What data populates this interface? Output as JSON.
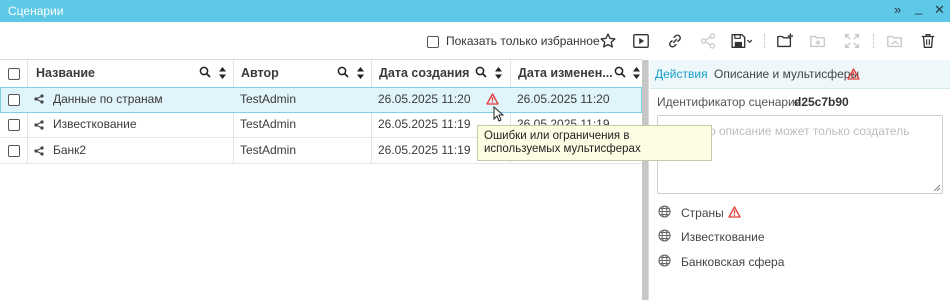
{
  "window": {
    "title": "Сценарии",
    "controls": [
      "»",
      "_",
      "✕"
    ]
  },
  "toolbar": {
    "favorites_label": "Показать только избранное",
    "icons": [
      "star-icon",
      "play-icon",
      "link-icon",
      "share-icon",
      "save-icon",
      "folder-add-icon",
      "folder-star-icon",
      "expand-icon",
      "folder-upload-icon",
      "trash-icon"
    ]
  },
  "grid": {
    "columns": [
      "Название",
      "Автор",
      "Дата создания",
      "Дата изменен..."
    ],
    "rows": [
      {
        "name": "Данные по странам",
        "author": "TestAdmin",
        "created": "26.05.2025 11:20",
        "modified": "26.05.2025 11:20",
        "warning": true,
        "selected": true
      },
      {
        "name": "Известкование",
        "author": "TestAdmin",
        "created": "26.05.2025 11:19",
        "modified": "26.05.2025 11:19"
      },
      {
        "name": "Банк2",
        "author": "TestAdmin",
        "created": "26.05.2025 11:19",
        "modified": ""
      }
    ]
  },
  "tooltip": {
    "text": "Ошибки или ограничения в используемых мультисферах"
  },
  "panel": {
    "tabs": [
      "Действия",
      "Описание и мультисферы"
    ],
    "id_label": "Идентификатор сценария:",
    "id_value": "d25c7b90",
    "description_placeholder": "о описание может только создатель",
    "multispheres": [
      {
        "name": "Страны",
        "warning": true
      },
      {
        "name": "Известкование"
      },
      {
        "name": "Банковская сфера"
      }
    ]
  },
  "colors": {
    "accent": "#5ec8e7",
    "tab_active": "#1a9fc9",
    "warning": "#e53935",
    "selected_row": "#e0f4fb"
  }
}
